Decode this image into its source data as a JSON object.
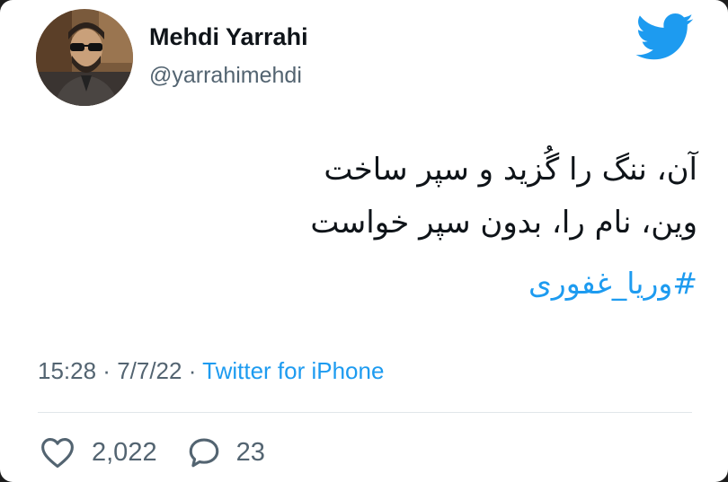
{
  "author": {
    "display_name": "Mehdi Yarrahi",
    "handle": "@yarrahimehdi",
    "avatar_icon": "profile-photo"
  },
  "brand": {
    "icon": "twitter-bird-icon",
    "color": "#1d9bf0"
  },
  "tweet": {
    "lines": [
      "آن، ننگ را گُزید و  سپر ساخت",
      "وین، نام را، بدون سپر خواست"
    ],
    "hashtag": "#وریا_غفوری"
  },
  "meta": {
    "time": "15:28",
    "separator1": " · ",
    "date": "7/7/22",
    "separator2": " · ",
    "source": "Twitter for iPhone"
  },
  "actions": {
    "like_icon": "heart-icon",
    "like_count": "2,022",
    "reply_icon": "speech-bubble-icon",
    "reply_count": "23"
  },
  "colors": {
    "text": "#0f1419",
    "secondary": "#536471",
    "link": "#1d9bf0",
    "background": "#ffffff"
  }
}
